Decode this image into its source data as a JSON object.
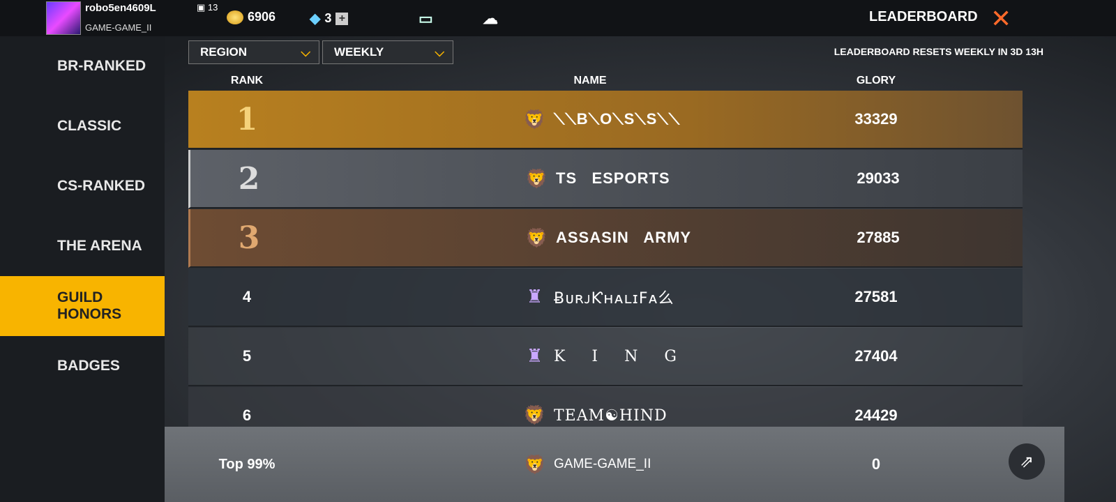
{
  "header": {
    "username": "robo5en4609L",
    "guild": "GAME-GAME_II",
    "level": "13",
    "gold": "6906",
    "diamonds": "3",
    "title": "LEADERBOARD"
  },
  "sidebar": {
    "items": [
      {
        "label": "BR-RANKED"
      },
      {
        "label": "CLASSIC"
      },
      {
        "label": "CS-RANKED"
      },
      {
        "label": "THE ARENA"
      },
      {
        "label": "GUILD HONORS",
        "active": true
      },
      {
        "label": "BADGES"
      }
    ]
  },
  "filters": {
    "region": "REGION",
    "period": "WEEKLY",
    "reset": "LEADERBOARD RESETS WEEKLY IN 3D 13H"
  },
  "columns": {
    "rank": "RANK",
    "name": "NAME",
    "glory": "GLORY"
  },
  "rows": [
    {
      "rank": "1",
      "name": "⟍⟍B⟍O⟍S⟍S⟍⟍",
      "glory": "33329",
      "emblem": "lion-icon"
    },
    {
      "rank": "2",
      "name": "TS   ESPORTS",
      "glory": "29033",
      "emblem": "lion-icon"
    },
    {
      "rank": "3",
      "name": "ASSASIN   ARMY",
      "glory": "27885",
      "emblem": "lion-icon"
    },
    {
      "rank": "4",
      "name": "ɃᴜʀᴊƘʜᴀʟɪFᴀ么",
      "glory": "27581",
      "emblem": "tower-icon"
    },
    {
      "rank": "5",
      "name": "K  I  N  G",
      "glory": "27404",
      "emblem": "tower-icon"
    },
    {
      "rank": "6",
      "name": "TEAM☯HIND",
      "glory": "24429",
      "emblem": "lion-icon"
    }
  ],
  "self": {
    "rank": "Top 99%",
    "name": "GAME-GAME_II",
    "glory": "0"
  },
  "colors": {
    "accent": "#f8b400",
    "close": "#ff6a2a"
  }
}
